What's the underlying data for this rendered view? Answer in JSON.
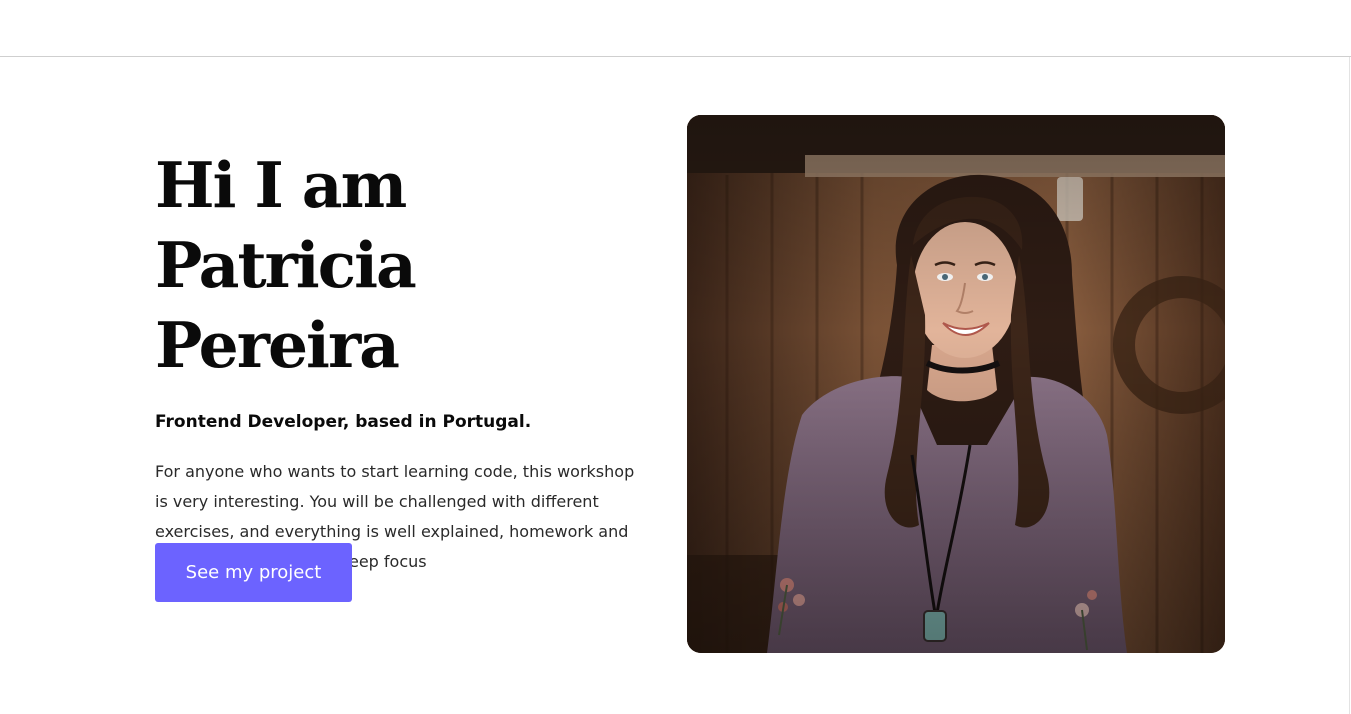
{
  "hero": {
    "title": "Hi I am Patricia Pereira",
    "subtitle": "Frontend Developer, based in Portugal.",
    "description": "For anyone who wants to start learning code, this workshop is very interesting. You will be challenged with different exercises, and everything is well explained, homework and deadlines are good for keep focus",
    "cta_label": "See my project"
  },
  "colors": {
    "accent": "#6c63ff",
    "text": "#0a0a0a",
    "background": "#ffffff"
  }
}
